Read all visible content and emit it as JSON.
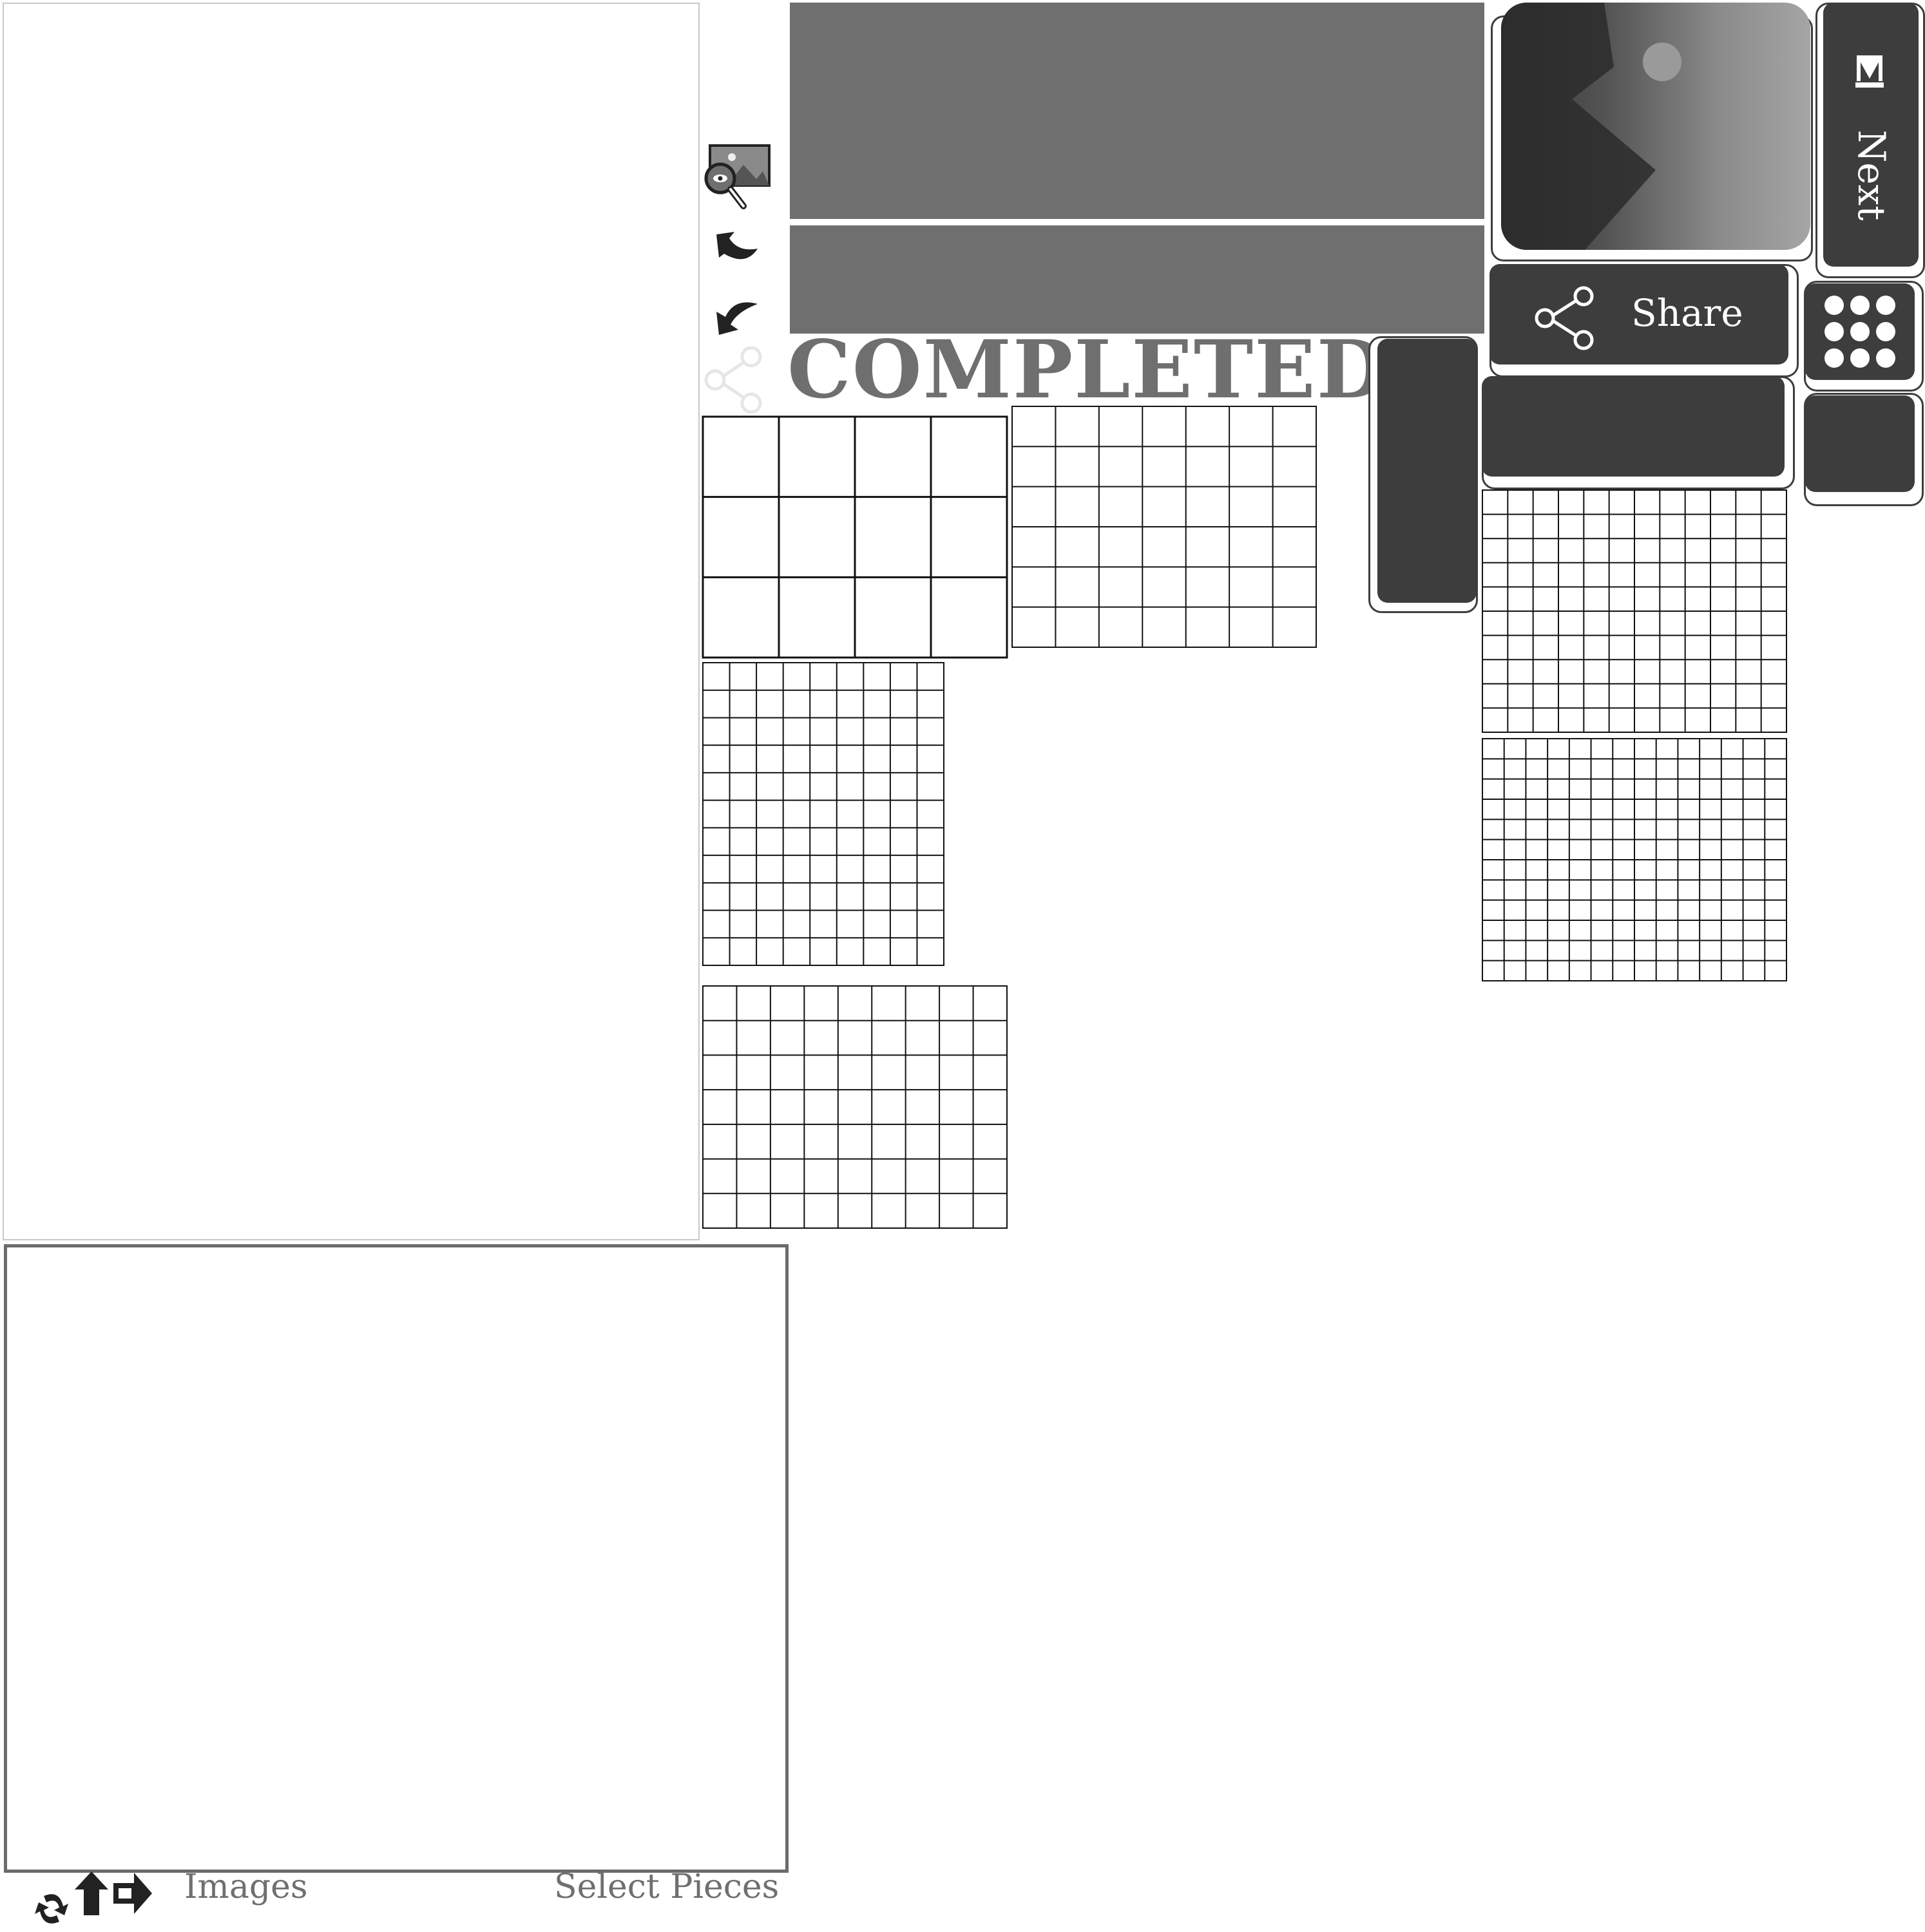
{
  "completed_banner": "COMPLETED!",
  "buttons": {
    "share_label": "Share",
    "next_label": "Next"
  },
  "bottom_bar": {
    "images_label": "Images",
    "select_pieces_label": "Select Pieces"
  },
  "icons": {
    "preview": "image-magnify-icon",
    "undo": "undo-arrow-icon",
    "redo": "redo-arrow-icon",
    "share": "share-nodes-icon",
    "next": "skip-next-icon",
    "menu": "dots-grid-icon",
    "rotate": "rotate-icon",
    "move": "move-arrows-icon"
  },
  "colors": {
    "dark_button": "#3d3d3d",
    "gray_bar": "#6f6f6f",
    "text_gray": "#6f6f6f"
  },
  "piece_grids": [
    {
      "id": "grid-3x4",
      "cols": 4,
      "rows": 3
    },
    {
      "id": "grid-6x7",
      "cols": 7,
      "rows": 6
    },
    {
      "id": "grid-11x9",
      "cols": 9,
      "rows": 11
    },
    {
      "id": "grid-7x9",
      "cols": 9,
      "rows": 7
    },
    {
      "id": "grid-10x12",
      "cols": 12,
      "rows": 10
    },
    {
      "id": "grid-12x14",
      "cols": 14,
      "rows": 12
    }
  ]
}
